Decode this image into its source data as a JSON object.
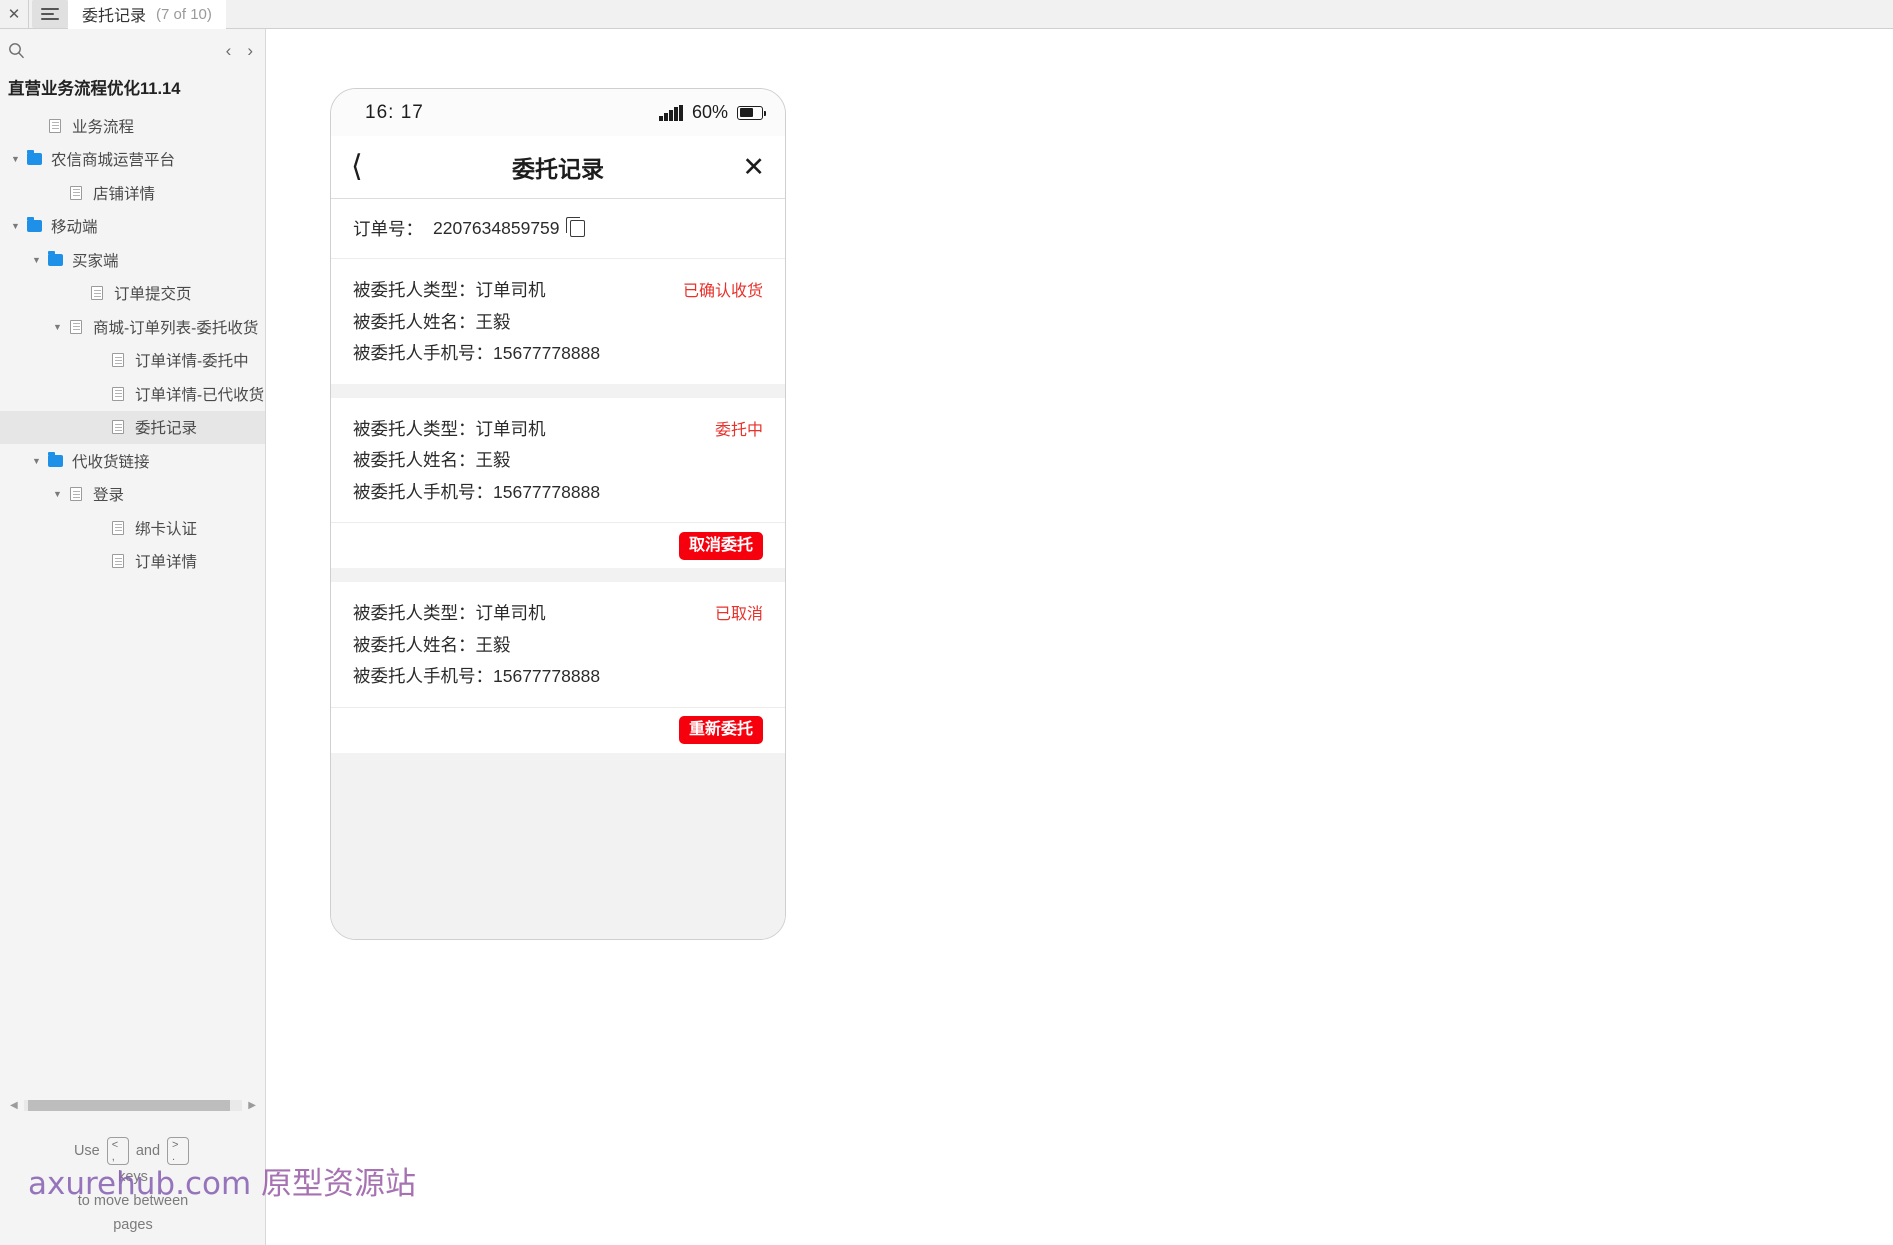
{
  "topbar": {
    "close_label": "✕",
    "menu_icon": "hamburger-icon",
    "tab_title": "委托记录",
    "tab_count": "(7 of 10)"
  },
  "sidebar": {
    "search_icon": "search-icon",
    "prev_label": "‹",
    "next_label": "›",
    "project_title": "直营业务流程优化11.14",
    "tree": [
      {
        "label": "业务流程",
        "indent": 1,
        "icon": "page",
        "caret": "none",
        "selected": false
      },
      {
        "label": "农信商城运营平台",
        "indent": 0,
        "icon": "folder",
        "caret": "expanded",
        "selected": false
      },
      {
        "label": "店铺详情",
        "indent": 2,
        "icon": "page",
        "caret": "none",
        "selected": false
      },
      {
        "label": "移动端",
        "indent": 0,
        "icon": "folder",
        "caret": "expanded",
        "selected": false
      },
      {
        "label": "买家端",
        "indent": 1,
        "icon": "folder",
        "caret": "expanded",
        "selected": false
      },
      {
        "label": "订单提交页",
        "indent": 3,
        "icon": "page",
        "caret": "none",
        "selected": false
      },
      {
        "label": "商城-订单列表-委托收货",
        "indent": 2,
        "icon": "page",
        "caret": "expanded",
        "selected": false
      },
      {
        "label": "订单详情-委托中",
        "indent": 4,
        "icon": "page",
        "caret": "none",
        "selected": false
      },
      {
        "label": "订单详情-已代收货",
        "indent": 4,
        "icon": "page",
        "caret": "none",
        "selected": false
      },
      {
        "label": "委托记录",
        "indent": 4,
        "icon": "page",
        "caret": "none",
        "selected": true
      },
      {
        "label": "代收货链接",
        "indent": 1,
        "icon": "folder",
        "caret": "expanded",
        "selected": false
      },
      {
        "label": "登录",
        "indent": 2,
        "icon": "page",
        "caret": "expanded",
        "selected": false
      },
      {
        "label": "绑卡认证",
        "indent": 4,
        "icon": "page",
        "caret": "none",
        "selected": false
      },
      {
        "label": "订单详情",
        "indent": 4,
        "icon": "page",
        "caret": "none",
        "selected": false
      }
    ],
    "hint": {
      "use": "Use",
      "key_prev": "<",
      "key_prev_sub": ",",
      "and": "and",
      "key_next": ">",
      "key_next_sub": ".",
      "keys_word": "keys",
      "tail_line1": "to move between",
      "tail_line2": "pages"
    },
    "scroll_left_icon": "triangle-left-icon",
    "scroll_right_icon": "triangle-right-icon"
  },
  "phone": {
    "status": {
      "time": "16: 17",
      "signal_icon": "signal-bars-icon",
      "battery_percent": "60%",
      "battery_icon": "battery-icon"
    },
    "nav": {
      "back_icon": "chevron-left-icon",
      "title": "委托记录",
      "close_icon": "close-icon"
    },
    "order": {
      "label": "订单号：",
      "value": "2207634859759",
      "copy_icon": "copy-icon"
    },
    "records": [
      {
        "type_label": "被委托人类型：订单司机",
        "name_label": "被委托人姓名：王毅",
        "phone_label": "被委托人手机号：15677778888",
        "status": "已确认收货",
        "status_color": "#e8312b",
        "action": null
      },
      {
        "type_label": "被委托人类型：订单司机",
        "name_label": "被委托人姓名：王毅",
        "phone_label": "被委托人手机号：15677778888",
        "status": "委托中",
        "status_color": "#e8312b",
        "action": "取消委托"
      },
      {
        "type_label": "被委托人类型：订单司机",
        "name_label": "被委托人姓名：王毅",
        "phone_label": "被委托人手机号：15677778888",
        "status": "已取消",
        "status_color": "#e8312b",
        "action": "重新委托"
      }
    ],
    "softkeys": {
      "back_icon": "chevron-left-icon",
      "home_icon": "home-square-icon",
      "recents_icon": "recents-bars-icon"
    }
  },
  "watermark": {
    "site": "axurehub.com",
    "cn": "原型资源站"
  },
  "colors": {
    "accent_red": "#f5000c",
    "status_red": "#e8312b",
    "folder_blue": "#1e90e8",
    "sidebar_bg": "#f4f4f4",
    "selected_row": "#e6e6e6"
  }
}
